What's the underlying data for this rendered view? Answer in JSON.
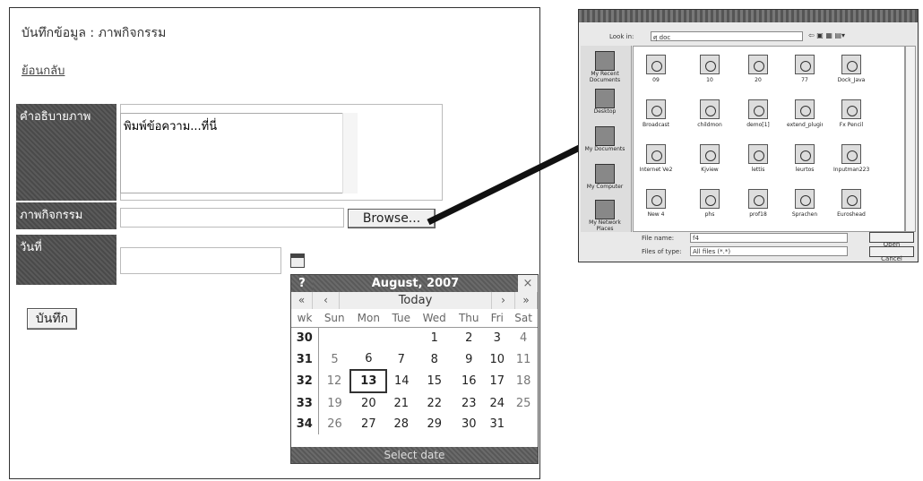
{
  "form": {
    "title": "บันทึกข้อมูล : ภาพกิจกรรม",
    "back_link": "ย้อนกลับ",
    "caption_label": "คำอธิบายภาพ",
    "caption_value": "พิมพ์ข้อความ...ที่นี่",
    "image_label": "ภาพกิจกรรม",
    "browse_label": "Browse...",
    "date_label": "วันที่",
    "save_label": "บันทึก"
  },
  "calendar": {
    "help": "?",
    "title": "August, 2007",
    "close": "×",
    "nav_prev_year": "«",
    "nav_prev": "‹",
    "nav_today": "Today",
    "nav_next": "›",
    "nav_next_year": "»",
    "headers": [
      "wk",
      "Sun",
      "Mon",
      "Tue",
      "Wed",
      "Thu",
      "Fri",
      "Sat"
    ],
    "weeks": [
      {
        "wk": "30",
        "days": [
          "",
          "",
          "",
          "1",
          "2",
          "3",
          "4"
        ]
      },
      {
        "wk": "31",
        "days": [
          "5",
          "6",
          "7",
          "8",
          "9",
          "10",
          "11"
        ]
      },
      {
        "wk": "32",
        "days": [
          "12",
          "13",
          "14",
          "15",
          "16",
          "17",
          "18"
        ]
      },
      {
        "wk": "33",
        "days": [
          "19",
          "20",
          "21",
          "22",
          "23",
          "24",
          "25"
        ]
      },
      {
        "wk": "34",
        "days": [
          "26",
          "27",
          "28",
          "29",
          "30",
          "31",
          ""
        ]
      }
    ],
    "today": "13",
    "footer": "Select date"
  },
  "dialog": {
    "look_in_label": "Look in:",
    "look_in_value": "ศุ doc",
    "places": [
      "My Recent Documents",
      "Desktop",
      "My Documents",
      "My Computer",
      "My Network Places"
    ],
    "files": [
      "09",
      "10",
      "20",
      "77",
      "Dock_Java",
      "Broadcast",
      "childmon",
      "demo[1]",
      "extend_plugin",
      "Fx Pencil",
      "Internet Ve2",
      "Kjview",
      "lettis",
      "leurtos",
      "Inputman223",
      "New 4",
      "phs",
      "prof18",
      "Sprachen",
      "Euroshead"
    ],
    "file_name_label": "File name:",
    "file_name_value": "f4",
    "file_type_label": "Files of type:",
    "file_type_value": "All files (*.*)",
    "open_label": "Open",
    "cancel_label": "Cancel"
  },
  "colors": {
    "label_bg": "#555555",
    "calendar_header": "#666666",
    "arrow": "#111111"
  }
}
